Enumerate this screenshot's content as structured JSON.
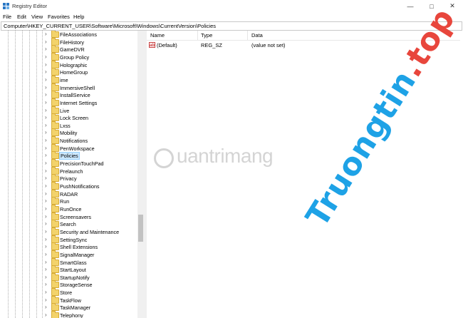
{
  "window": {
    "title": "Registry Editor",
    "minimize_icon": "minimize-icon",
    "maximize_icon": "maximize-icon",
    "close_icon": "close-icon"
  },
  "menu": [
    "File",
    "Edit",
    "View",
    "Favorites",
    "Help"
  ],
  "address": "Computer\\HKEY_CURRENT_USER\\Software\\Microsoft\\Windows\\CurrentVersion\\Policies",
  "tree": {
    "selected": "Policies",
    "items": [
      "FileAssociations",
      "FileHistory",
      "GameDVR",
      "Group Policy",
      "Holographic",
      "HomeGroup",
      "ime",
      "ImmersiveShell",
      "InstallService",
      "Internet Settings",
      "Live",
      "Lock Screen",
      "Lxss",
      "Mobility",
      "Notifications",
      "PenWorkspace",
      "Policies",
      "PrecisionTouchPad",
      "Prelaunch",
      "Privacy",
      "PushNotifications",
      "RADAR",
      "Run",
      "RunOnce",
      "Screensavers",
      "Search",
      "Security and Maintenance",
      "SettingSync",
      "Shell Extensions",
      "SignalManager",
      "SmartGlass",
      "StartLayout",
      "StartupNotify",
      "StorageSense",
      "Store",
      "TaskFlow",
      "TaskManager",
      "Telephony"
    ]
  },
  "columns": {
    "name": "Name",
    "type": "Type",
    "data": "Data"
  },
  "values": [
    {
      "name": "(Default)",
      "type": "REG_SZ",
      "data": "(value not set)"
    }
  ],
  "watermark": {
    "logo": "uantrimang",
    "big_blue": "Truongtin",
    "big_red": ".top"
  },
  "colors": {
    "folder": "#f3d36b",
    "selection": "#cce8ff",
    "wm_blue": "#1ea2e6",
    "wm_red": "#e8463c"
  }
}
